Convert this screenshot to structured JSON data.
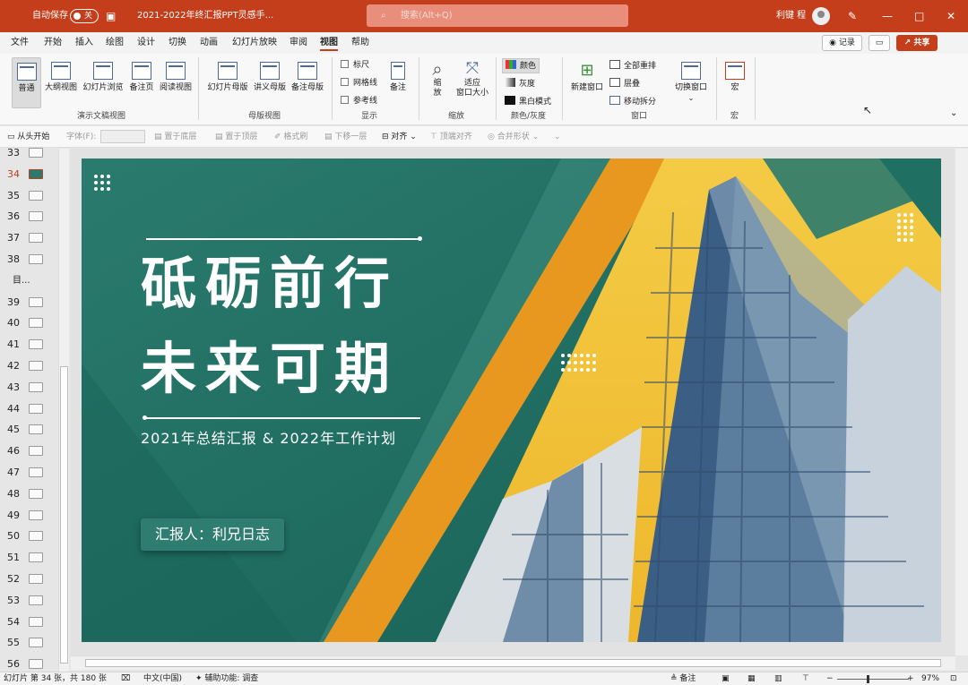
{
  "titlebar": {
    "autosave_label": "自动保存",
    "autosave_state": "关",
    "doc_title": "2021-2022年终汇报PPT灵感手...",
    "search_placeholder": "搜索(Alt+Q)",
    "user_name": "利键 程"
  },
  "menu": {
    "tabs": [
      "文件",
      "开始",
      "插入",
      "绘图",
      "设计",
      "切换",
      "动画",
      "幻灯片放映",
      "审阅",
      "视图",
      "帮助"
    ],
    "active": "视图",
    "record": "记录",
    "share": "共享"
  },
  "ribbon": {
    "presentation_views": [
      "普通",
      "大纲视图",
      "幻灯片浏览",
      "备注页",
      "阅读视图"
    ],
    "presentation_views_group": "演示文稿视图",
    "master_views": [
      "幻灯片母版",
      "讲义母版",
      "备注母版"
    ],
    "master_views_group": "母版视图",
    "show": [
      "标尺",
      "网格线",
      "参考线"
    ],
    "notes": "备注",
    "show_group": "显示",
    "zoom": "缩\n放",
    "fit_window": "适应\n窗口大小",
    "zoom_group": "缩放",
    "color": "颜色",
    "grayscale": "灰度",
    "bw": "黑白模式",
    "color_group": "颜色/灰度",
    "new_window": "新建窗口",
    "arrange_all": "全部重排",
    "cascade": "层叠",
    "move_split": "移动拆分",
    "switch_window": "切换窗口",
    "window_group": "窗口",
    "macros": "宏",
    "macros_group": "宏"
  },
  "qat": {
    "from_start": "从头开始",
    "font_label": "字体(F):",
    "send_to_back": "置于底层",
    "bring_to_front": "置于顶层",
    "format_painter": "格式刷",
    "send_backward": "下移一层",
    "align": "对齐",
    "align_top": "顶端对齐",
    "merge_shapes": "合并形状"
  },
  "thumbnails": [
    "33",
    "34",
    "35",
    "36",
    "37",
    "38",
    "目...",
    "39",
    "40",
    "41",
    "42",
    "43",
    "44",
    "45",
    "46",
    "47",
    "48",
    "49",
    "50",
    "51",
    "52",
    "53",
    "54",
    "55",
    "56"
  ],
  "active_slide": "34",
  "slide": {
    "title_line1": "砥砺前行",
    "title_line2": "未来可期",
    "subtitle": "2021年总结汇报 & 2022年工作计划",
    "reporter": "汇报人：利兄日志"
  },
  "status": {
    "slide_info": "幻灯片 第 34 张，共 180 张",
    "language": "中文(中国)",
    "accessibility": "辅助功能: 调查",
    "notes": "备注",
    "zoom": "97%"
  },
  "colors": {
    "accent": "#c43e1c",
    "slide_green": "#1f6f63",
    "slide_yellow": "#f2c23a",
    "slide_orange": "#e8971f"
  }
}
